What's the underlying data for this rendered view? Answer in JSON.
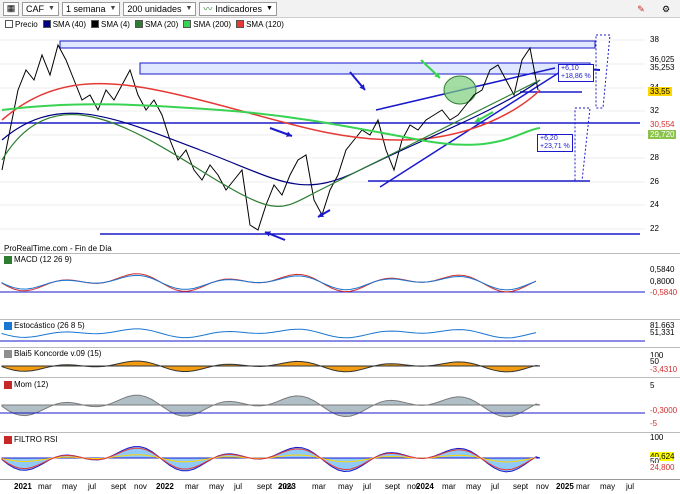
{
  "toolbar": {
    "symbol": "CAF",
    "period": "1 semana",
    "units": "200 unidades",
    "indicators": "Indicadores"
  },
  "legend": [
    {
      "label": "Precio",
      "color": "#ffffff"
    },
    {
      "label": "SMA (40)",
      "color": "#000080"
    },
    {
      "label": "SMA (4)",
      "color": "#000000"
    },
    {
      "label": "SMA (20)",
      "color": "#2e7d32"
    },
    {
      "label": "SMA (200)",
      "color": "#39d353"
    },
    {
      "label": "SMA (120)",
      "color": "#e53935"
    }
  ],
  "price_axis": {
    "ticks": [
      "38",
      "36",
      "34",
      "32",
      "30",
      "28",
      "26",
      "24",
      "22"
    ],
    "labels": [
      {
        "text": "36,025",
        "color": "#ffffff",
        "text_color": "#000000"
      },
      {
        "text": "35,253",
        "color": "#ffffff",
        "text_color": "#000000"
      },
      {
        "text": "33,55",
        "color": "#ffd700",
        "text_color": "#000000"
      },
      {
        "text": "30,554",
        "color": "#ffffff",
        "text_color": "#d32f2f"
      },
      {
        "text": "29,720",
        "color": "#8bc34a",
        "text_color": "#ffffff"
      }
    ]
  },
  "annotations": {
    "box1": "+6,10\n+18,86 %",
    "box1_l1": "+6,10",
    "box1_l2": "+18,86 %",
    "box2_l1": "+6,20",
    "box2_l2": "+23,71 %"
  },
  "credit": "ProRealTime.com - Fin de Día",
  "panels": {
    "macd": {
      "label": "MACD (12 26 9)",
      "ticks": [
        "0,5840",
        "0,8000",
        "-0,5840"
      ]
    },
    "stoch": {
      "label": "Estocástico (26 8 5)",
      "ticks": [
        "81,663",
        "51,331"
      ]
    },
    "blai5": {
      "label": "Blai5 Koncorde v.09 (15)",
      "ticks": [
        "100",
        "50",
        "-3,4310"
      ]
    },
    "mom": {
      "label": "Mom (12)",
      "ticks": [
        "5",
        "-0,3000",
        "-5"
      ]
    },
    "rsi": {
      "label": "FILTRO RSI",
      "ticks": [
        "100",
        "40,624",
        "50",
        "24,800"
      ]
    }
  },
  "xaxis": [
    {
      "text": "2021",
      "year": true
    },
    {
      "text": "mar"
    },
    {
      "text": "may"
    },
    {
      "text": "jul"
    },
    {
      "text": "sept"
    },
    {
      "text": "nov"
    },
    {
      "text": "2022",
      "year": true
    },
    {
      "text": "mar"
    },
    {
      "text": "may"
    },
    {
      "text": "jul"
    },
    {
      "text": "sept"
    },
    {
      "text": "nov"
    },
    {
      "text": "2023",
      "year": true
    },
    {
      "text": "mar"
    },
    {
      "text": "may"
    },
    {
      "text": "jul"
    },
    {
      "text": "sept"
    },
    {
      "text": "nov"
    },
    {
      "text": "2024",
      "year": true
    },
    {
      "text": "mar"
    },
    {
      "text": "may"
    },
    {
      "text": "jul"
    },
    {
      "text": "sept"
    },
    {
      "text": "nov"
    },
    {
      "text": "2025",
      "year": true
    },
    {
      "text": "mar"
    },
    {
      "text": "may"
    },
    {
      "text": "jul"
    }
  ],
  "colors": {
    "price_up": "#ffffff",
    "price_down": "#000000",
    "sma40": "#000080",
    "sma20": "#2e7d32",
    "sma200": "#39d353",
    "sma120": "#e53935",
    "trendline": "#1a1acc"
  }
}
